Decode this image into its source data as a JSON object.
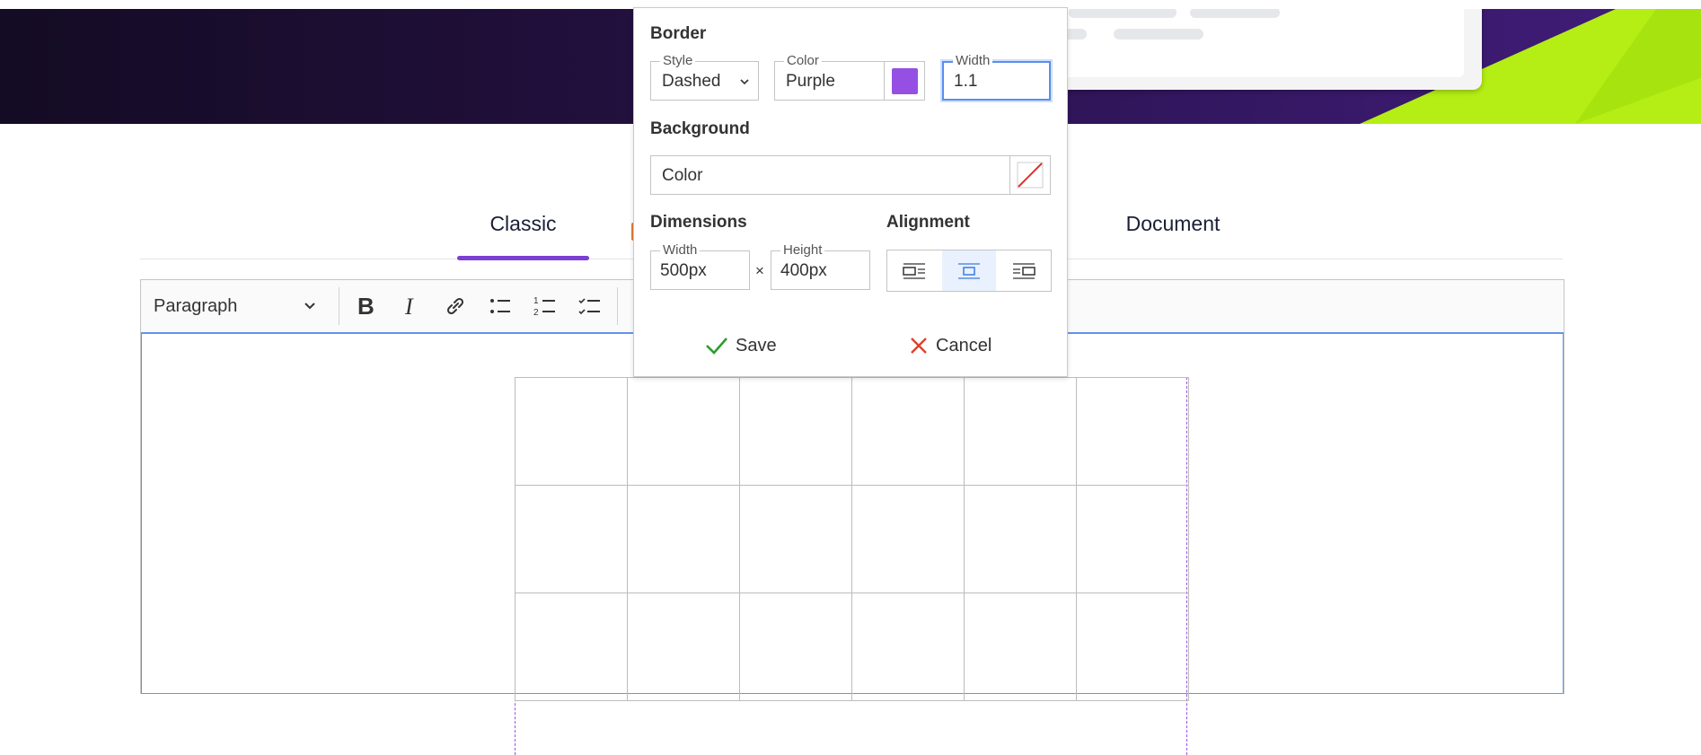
{
  "panel": {
    "border": {
      "title": "Border",
      "style": {
        "label": "Style",
        "value": "Dashed"
      },
      "color": {
        "label": "Color",
        "value": "Purple",
        "swatch": "#9550e3"
      },
      "width": {
        "label": "Width",
        "value": "1.1"
      }
    },
    "background": {
      "title": "Background",
      "placeholder": "Color"
    },
    "dimensions": {
      "title": "Dimensions",
      "width": {
        "label": "Width",
        "value": "500px"
      },
      "times": "×",
      "height": {
        "label": "Height",
        "value": "400px"
      }
    },
    "alignment": {
      "title": "Alignment",
      "selected": "center"
    },
    "save_label": "Save",
    "cancel_label": "Cancel"
  },
  "tabs": [
    {
      "label": "Classic",
      "active": true
    },
    {
      "label": "Document",
      "active": false
    }
  ],
  "toolbar": {
    "block_format": "Paragraph",
    "icons": [
      "bold-icon",
      "italic-icon",
      "link-icon",
      "bulleted-list-icon",
      "numbered-list-icon",
      "todo-list-icon"
    ]
  },
  "colors": {
    "accent": "#7b3fd2",
    "table_border": "#9b4fe0",
    "focus": "#5b8def",
    "save_check": "#2e9b2e",
    "cancel_x": "#e0402a"
  }
}
